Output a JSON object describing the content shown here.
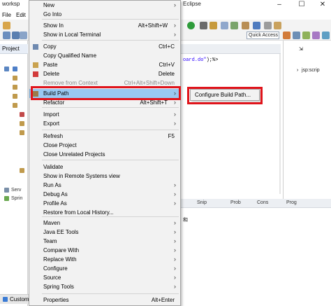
{
  "window": {
    "title_left": "worksp",
    "title_right": "Eclipse",
    "min_label": "–",
    "max_label": "☐",
    "close_label": "✕"
  },
  "menubar": {
    "items": [
      "File",
      "Edit"
    ]
  },
  "toolbar": {
    "quick_access": "Quick Access"
  },
  "explorer": {
    "tab_label": "Project",
    "tree": [
      "Serv",
      "Sprin"
    ],
    "bottom_tab": "Custome"
  },
  "editor": {
    "code_text": "oard.do\"",
    "code_tail": ");%>"
  },
  "outline": {
    "item": "jsp:scrip"
  },
  "bottom_tabs": [
    "Snip",
    "Prob",
    "Cons",
    "Prog"
  ],
  "bottom_code": "和",
  "context_menu": {
    "items": [
      {
        "label": "New",
        "shortcut": "",
        "submenu": true
      },
      {
        "label": "Go Into",
        "shortcut": "",
        "submenu": false
      },
      {
        "label": "Show In",
        "shortcut": "Alt+Shift+W",
        "submenu": true
      },
      {
        "label": "Show in Local Terminal",
        "shortcut": "",
        "submenu": true
      },
      {
        "label": "Copy",
        "shortcut": "Ctrl+C",
        "submenu": false
      },
      {
        "label": "Copy Qualified Name",
        "shortcut": "",
        "submenu": false
      },
      {
        "label": "Paste",
        "shortcut": "Ctrl+V",
        "submenu": false
      },
      {
        "label": "Delete",
        "shortcut": "Delete",
        "submenu": false
      },
      {
        "label": "Remove from Context",
        "shortcut": "Ctrl+Alt+Shift+Down",
        "submenu": false,
        "disabled": true
      },
      {
        "label": "Build Path",
        "shortcut": "",
        "submenu": true,
        "highlighted": true
      },
      {
        "label": "Refactor",
        "shortcut": "Alt+Shift+T",
        "submenu": true
      },
      {
        "label": "Import",
        "shortcut": "",
        "submenu": true
      },
      {
        "label": "Export",
        "shortcut": "",
        "submenu": true
      },
      {
        "label": "Refresh",
        "shortcut": "F5",
        "submenu": false
      },
      {
        "label": "Close Project",
        "shortcut": "",
        "submenu": false
      },
      {
        "label": "Close Unrelated Projects",
        "shortcut": "",
        "submenu": false
      },
      {
        "label": "Validate",
        "shortcut": "",
        "submenu": false
      },
      {
        "label": "Show in Remote Systems view",
        "shortcut": "",
        "submenu": false
      },
      {
        "label": "Run As",
        "shortcut": "",
        "submenu": true
      },
      {
        "label": "Debug As",
        "shortcut": "",
        "submenu": true
      },
      {
        "label": "Profile As",
        "shortcut": "",
        "submenu": true
      },
      {
        "label": "Restore from Local History...",
        "shortcut": "",
        "submenu": false
      },
      {
        "label": "Maven",
        "shortcut": "",
        "submenu": true
      },
      {
        "label": "Java EE Tools",
        "shortcut": "",
        "submenu": true
      },
      {
        "label": "Team",
        "shortcut": "",
        "submenu": true
      },
      {
        "label": "Compare With",
        "shortcut": "",
        "submenu": true
      },
      {
        "label": "Replace With",
        "shortcut": "",
        "submenu": true
      },
      {
        "label": "Configure",
        "shortcut": "",
        "submenu": true
      },
      {
        "label": "Source",
        "shortcut": "",
        "submenu": true
      },
      {
        "label": "Spring Tools",
        "shortcut": "",
        "submenu": true
      },
      {
        "label": "Properties",
        "shortcut": "Alt+Enter",
        "submenu": false
      }
    ],
    "arrow": "›"
  },
  "submenu": {
    "label": "Configure Build Path..."
  },
  "colors": {
    "highlight": "#99c9f2",
    "annotation_red": "#e0141b",
    "menu_bg": "#f2f2f2"
  }
}
